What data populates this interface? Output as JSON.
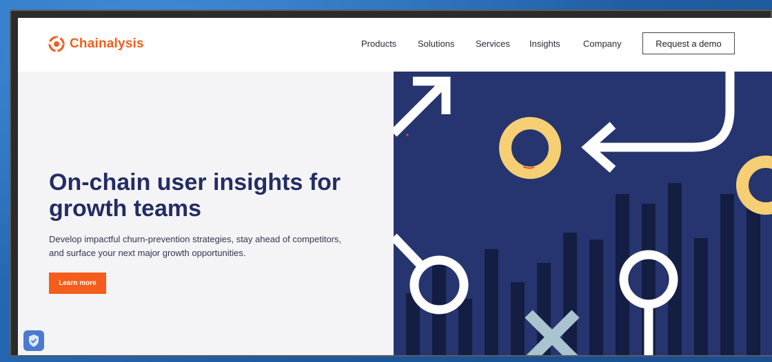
{
  "brand": {
    "name": "Chainalysis",
    "color": "#f45d1b"
  },
  "nav": {
    "items": [
      "Products",
      "Solutions",
      "Services",
      "Insights",
      "Company"
    ],
    "cta_label": "Request a demo"
  },
  "hero": {
    "title": "On-chain user insights for growth teams",
    "body": "Develop impactful churn-prevention strategies, stay ahead of competitors, and surface your next major growth opportunities.",
    "button_label": "Learn more"
  },
  "colors": {
    "title": "#232c63",
    "art_background": "#26356f",
    "art_bars": "#141d42",
    "art_ring_yellow": "#f6ce74",
    "art_x": "#a9c4cf"
  },
  "icons": {
    "logo": "chainalysis-logo-icon",
    "badge": "shield-check-icon"
  }
}
